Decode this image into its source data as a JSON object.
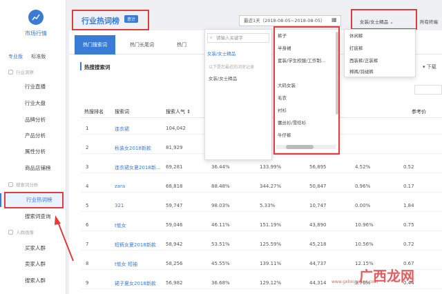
{
  "sidebar": {
    "logo_title": "市场行情",
    "mode_tabs": [
      "专业版",
      "标准版"
    ],
    "groups": [
      {
        "label": "行业洞察"
      },
      {
        "label": "搜索词分析"
      },
      {
        "label": "人群画像"
      }
    ],
    "items": [
      {
        "label": "行业直播"
      },
      {
        "label": "行业大盘"
      },
      {
        "label": "品牌分析"
      },
      {
        "label": "产品分析"
      },
      {
        "label": "属性分析"
      },
      {
        "label": "商品店铺榜"
      },
      {
        "label": "行业热词榜"
      },
      {
        "label": "搜索词查询"
      },
      {
        "label": "买家人群"
      },
      {
        "label": "卖家人群"
      },
      {
        "label": "搜索人群"
      }
    ]
  },
  "header": {
    "title": "行业热词榜",
    "badge": "意计",
    "date_range": "最近1天（2018-08-05~2018-08-05）",
    "category_select": "女装/女士精品",
    "terminal": "所有终端"
  },
  "tabs": [
    "热门搜索词",
    "热门长尾词",
    "热门"
  ],
  "section": {
    "title": "热搜搜索词",
    "download": "下载"
  },
  "dropdown": {
    "search_placeholder": "请输入关键字",
    "selected": "女装/女士精品",
    "hint": "以下是您最近的浏览记录",
    "history": "女装/女士精品",
    "sub_items": [
      "裤子",
      "半身裙",
      "套装/学生校服/工作制...",
      "大码女装",
      "毛衣",
      "衬衫",
      "蕾丝衫/雪纺衫",
      "牛仔裤"
    ],
    "leaf_items": [
      "休闲裤",
      "打底裤",
      "西装裤/正装裤",
      "棉裤/羽绒裤"
    ]
  },
  "table": {
    "headers": [
      "热搜排名",
      "搜索词",
      "搜索人气",
      "",
      "",
      "",
      "",
      "参考价"
    ],
    "rows": [
      {
        "rank": "1",
        "kw": "连衣裙",
        "pop": "104,042",
        "c1": "",
        "c2": "",
        "c3": "",
        "c4": "",
        "c5": ""
      },
      {
        "rank": "2",
        "kw": "秋装女2018新款",
        "pop": "81,929",
        "c1": "",
        "c2": "",
        "c3": "",
        "c4": "",
        "c5": ""
      },
      {
        "rank": "3",
        "kw": "连衣裙女夏2018新...",
        "pop": "69,281",
        "c1": "36.44%",
        "c2": "133.99%",
        "c3": "56,895",
        "c4": "4.52%",
        "c5": "0.52"
      },
      {
        "rank": "4",
        "kw": "zara",
        "pop": "68,818",
        "c1": "88.48%",
        "c2": "344.27%",
        "c3": "50,847",
        "c4": "0.96%",
        "c5": "0.17"
      },
      {
        "rank": "5",
        "kw": "321",
        "pop": "59,747",
        "c1": "98.03%",
        "c2": "5.33%",
        "c3": "10,747",
        "c4": "0.00%",
        "c5": "1.84"
      },
      {
        "rank": "6",
        "kw": "t恤女",
        "pop": "59,046",
        "c1": "46.11%",
        "c2": "151.19%",
        "c3": "43,890",
        "c4": "10.96%",
        "c5": "0.75"
      },
      {
        "rank": "7",
        "kw": "短裤女夏2018新款",
        "pop": "58,942",
        "c1": "53.51%",
        "c2": "125.59%",
        "c3": "45,218",
        "c4": "10.56%",
        "c5": "0.72"
      },
      {
        "rank": "8",
        "kw": "t恤女 短袖",
        "pop": "58,256",
        "c1": "45.55%",
        "c2": "139.11%",
        "c3": "44,737",
        "c4": "12.15%",
        "c5": "0.67"
      },
      {
        "rank": "9",
        "kw": "裙子夏女2018新款",
        "pop": "56,982",
        "c1": "36.68%",
        "c2": "129.12%",
        "c3": "44,314",
        "c4": "3.76%",
        "c5": "0.44"
      }
    ]
  },
  "watermark": {
    "text": "广西龙网",
    "sub": "www.gxlongwang.com"
  }
}
